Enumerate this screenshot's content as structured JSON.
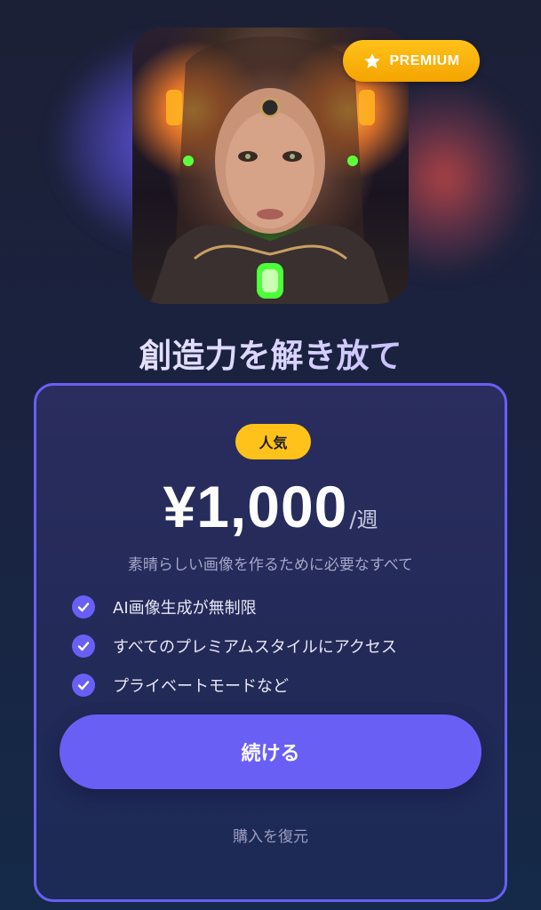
{
  "badge": {
    "label": "PREMIUM",
    "icon": "star-icon",
    "color": "#ffc21a"
  },
  "headline": "創造力を解き放て",
  "plan": {
    "popular_label": "人気",
    "price": "¥1,000",
    "period": "/週",
    "tagline": "素晴らしい画像を作るために必要なすべて",
    "features": [
      {
        "text": "AI画像生成が無制限",
        "icon": "check-circle-icon"
      },
      {
        "text": "すべてのプレミアムスタイルにアクセス",
        "icon": "check-circle-icon"
      },
      {
        "text": "プライベートモードなど",
        "icon": "check-circle-icon"
      }
    ],
    "continue_label": "続ける",
    "restore_label": "購入を復元"
  },
  "colors": {
    "accent": "#6a5ff5",
    "badge": "#ffc21a",
    "background": "#1b2240"
  }
}
